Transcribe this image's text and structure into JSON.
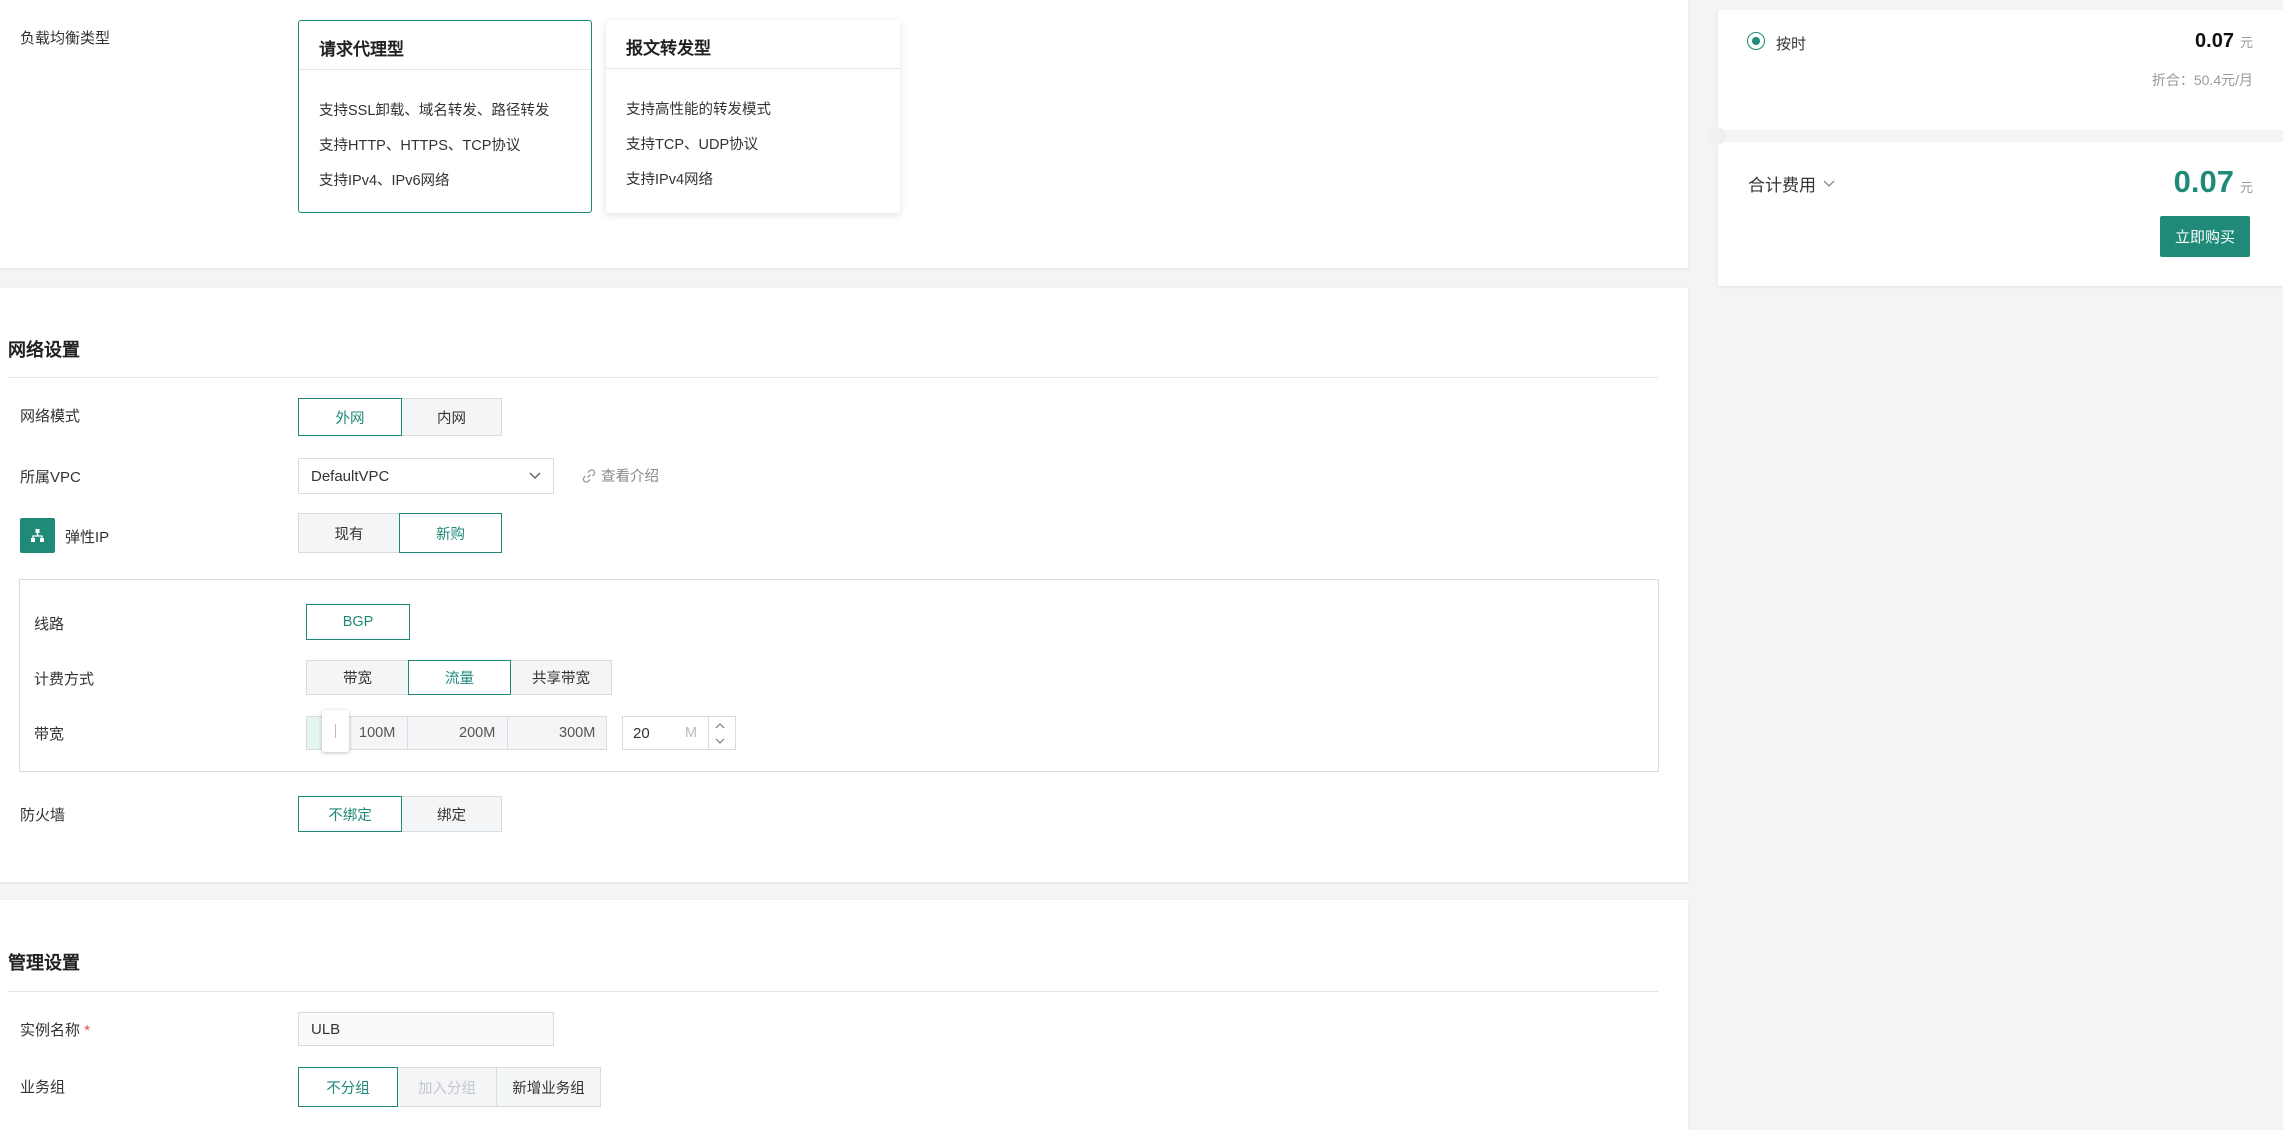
{
  "lb_type": {
    "label": "负载均衡类型",
    "options": [
      {
        "title": "请求代理型",
        "features": [
          "支持SSL卸载、域名转发、路径转发",
          "支持HTTP、HTTPS、TCP协议",
          "支持IPv4、IPv6网络"
        ]
      },
      {
        "title": "报文转发型",
        "features": [
          "支持高性能的转发模式",
          "支持TCP、UDP协议",
          "支持IPv4网络"
        ]
      }
    ]
  },
  "network": {
    "title": "网络设置",
    "mode": {
      "label": "网络模式",
      "options": [
        "外网",
        "内网"
      ]
    },
    "vpc": {
      "label": "所属VPC",
      "value": "DefaultVPC",
      "link": "查看介绍"
    },
    "eip": {
      "label": "弹性IP",
      "options": [
        "现有",
        "新购"
      ],
      "line": {
        "label": "线路",
        "value": "BGP"
      },
      "billing": {
        "label": "计费方式",
        "options": [
          "带宽",
          "流量",
          "共享带宽"
        ]
      },
      "bandwidth": {
        "label": "带宽",
        "marks": [
          "100M",
          "200M",
          "300M"
        ],
        "value": "20",
        "unit": "M"
      }
    },
    "firewall": {
      "label": "防火墙",
      "options": [
        "不绑定",
        "绑定"
      ]
    }
  },
  "manage": {
    "title": "管理设置",
    "name": {
      "label": "实例名称",
      "required": "*",
      "value": "ULB"
    },
    "group": {
      "label": "业务组",
      "options": [
        "不分组",
        "加入分组",
        "新增业务组"
      ]
    }
  },
  "price": {
    "hourly_label": "按时",
    "hourly_value": "0.07",
    "currency": "元",
    "monthly": "折合：50.4元/月",
    "total_label": "合计费用",
    "total_value": "0.07",
    "buy_label": "立即购买"
  },
  "colors": {
    "accent": "#1f8a78"
  }
}
